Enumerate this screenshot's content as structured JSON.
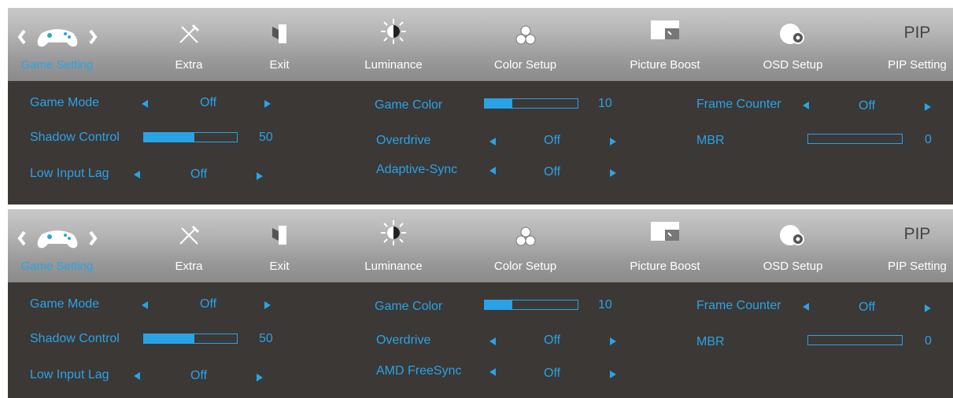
{
  "tabs": [
    {
      "label": "Game Setting",
      "active": true
    },
    {
      "label": "Extra"
    },
    {
      "label": "Exit"
    },
    {
      "label": "Luminance"
    },
    {
      "label": "Color Setup"
    },
    {
      "label": "Picture Boost"
    },
    {
      "label": "OSD Setup"
    },
    {
      "label": "PIP Setting",
      "icon_text": "PIP"
    }
  ],
  "colors": {
    "accent": "#2aa3e6",
    "panel": "#3b3836"
  },
  "panels": [
    {
      "game_mode": {
        "label": "Game Mode",
        "value": "Off"
      },
      "shadow_control": {
        "label": "Shadow Control",
        "value": "50",
        "level": 0.54
      },
      "low_input_lag": {
        "label": "Low Input Lag",
        "value": "Off"
      },
      "game_color": {
        "label": "Game Color",
        "value": "10",
        "level": 0.3
      },
      "overdrive": {
        "label": "Overdrive",
        "value": "Off"
      },
      "sync": {
        "label": "Adaptive-Sync",
        "value": "Off"
      },
      "frame_counter": {
        "label": "Frame Counter",
        "value": "Off"
      },
      "mbr": {
        "label": "MBR",
        "value": "0",
        "level": 0
      }
    },
    {
      "game_mode": {
        "label": "Game Mode",
        "value": "Off"
      },
      "shadow_control": {
        "label": "Shadow Control",
        "value": "50",
        "level": 0.54
      },
      "low_input_lag": {
        "label": "Low Input Lag",
        "value": "Off"
      },
      "game_color": {
        "label": "Game Color",
        "value": "10",
        "level": 0.3
      },
      "overdrive": {
        "label": "Overdrive",
        "value": "Off"
      },
      "sync": {
        "label": "AMD FreeSync",
        "value": "Off"
      },
      "frame_counter": {
        "label": "Frame Counter",
        "value": "Off"
      },
      "mbr": {
        "label": "MBR",
        "value": "0",
        "level": 0
      }
    }
  ]
}
